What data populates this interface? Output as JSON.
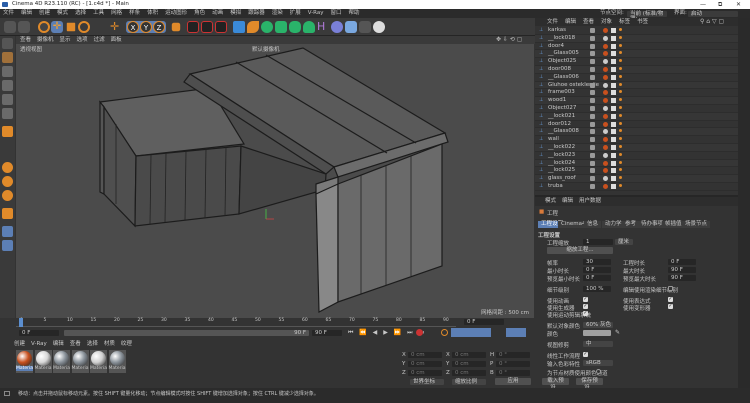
{
  "window": {
    "title": "Cinema 4D R23.110 (RC) - [1.c4d *] - Main",
    "minimize": "—",
    "restore": "⧉",
    "close": "✕"
  },
  "menu": [
    "文件",
    "编辑",
    "创建",
    "模式",
    "选择",
    "工具",
    "网格",
    "样条",
    "体积",
    "运动图形",
    "角色",
    "动画",
    "模拟",
    "跟踪器",
    "渲染",
    "扩展",
    "V-Ray",
    "窗口",
    "帮助"
  ],
  "header": {
    "node_space_label": "节点空间:",
    "node_space_value": "当前 (标准/物理)",
    "layout_label": "界面:",
    "layout_value": "启动"
  },
  "viewport": {
    "menu": [
      "查看",
      "摄像机",
      "显示",
      "选项",
      "过滤",
      "面板"
    ],
    "name": "透视视图",
    "camera": "默认摄像机",
    "grid": "网格间距 : 500 cm",
    "colors": {
      "bg": "#4b4b4b",
      "roof": "#5a5a5a",
      "wall": "#6a6a6a",
      "edge": "#1c1c1c"
    }
  },
  "object_manager": {
    "menu": [
      "文件",
      "编辑",
      "查看",
      "对象",
      "标签",
      "书签"
    ],
    "objects": [
      "karkas",
      "__lock018",
      "door4",
      "__Glass005",
      "Object025",
      "door008",
      "__Glass006",
      "Gluhoe ostekleniie",
      "frame003",
      "wood1",
      "Object027",
      "__lock021",
      "door012",
      "__Glass008",
      "wall",
      "__lock022",
      "__lock023",
      "__lock024",
      "__lock025",
      "glass_roof",
      "truba"
    ]
  },
  "attributes": {
    "menu": [
      "模式",
      "编辑",
      "用户数据"
    ],
    "object": "工程",
    "tabs": [
      "工程设置",
      "Cinema4D",
      "信息",
      "动力学",
      "参考",
      "待办事项",
      "帧插值",
      "场景节点"
    ],
    "section": "工程设置",
    "scale_label": "工程缩放",
    "scale_value": "1",
    "scale_unit": "厘米",
    "scale_button": "缩放工程...",
    "fps_label": "帧率",
    "fps_value": "30",
    "proj_time_label": "工程时长",
    "proj_time_value": "0 F",
    "min_time_label": "最小时长",
    "min_time_value": "0 F",
    "max_time_label": "最大时长",
    "max_time_value": "90 F",
    "prev_min_label": "预览最小时长",
    "prev_min_value": "0 F",
    "prev_max_label": "预览最大时长",
    "prev_max_value": "90 F",
    "lod_label": "细节级别",
    "lod_value": "100 %",
    "render_lod_label": "编辑使用渲染细节级别",
    "use_anim": "使用动画",
    "use_expr": "使用表达式",
    "use_gen": "使用生成器",
    "use_deform": "使用变形器",
    "use_motion": "使用运动剪辑系统",
    "obj_color_label": "默认对象颜色",
    "obj_color_value": "60% 灰色",
    "color_label": "颜色",
    "clip_label": "视图修剪",
    "clip_value": "中",
    "linear_label": "线性工作流程",
    "input_color_label": "输入色彩特性",
    "input_color_value": "sRGB",
    "node_color_label": "为节点材质使用颜色通道",
    "load_preset": "载入预设...",
    "save_preset": "保存预设..."
  },
  "timeline": {
    "ticks": [
      "0",
      "5",
      "10",
      "15",
      "20",
      "25",
      "30",
      "35",
      "40",
      "45",
      "50",
      "55",
      "60",
      "65",
      "70",
      "75",
      "80",
      "85",
      "90"
    ],
    "current": "0 F",
    "start": "0 F",
    "range_end": "90 F",
    "end": "90 F",
    "playhead": 0
  },
  "materials": {
    "menu": [
      "创建",
      "V-Ray",
      "编辑",
      "查看",
      "选择",
      "材质",
      "纹理"
    ],
    "items": [
      {
        "name": "Materia",
        "color": "#c8501e"
      },
      {
        "name": "Materia",
        "color": "#d8d8d8"
      },
      {
        "name": "Materia",
        "color": "#8a929a"
      },
      {
        "name": "Materia",
        "color": "#8a929a"
      },
      {
        "name": "Materia",
        "color": "#d0d0d0"
      },
      {
        "name": "Materia",
        "color": "#8a929a"
      }
    ]
  },
  "coordinates": {
    "rows": [
      [
        "X",
        "0 cm",
        "X",
        "0 cm",
        "H",
        "0 °"
      ],
      [
        "Y",
        "0 cm",
        "Y",
        "0 cm",
        "P",
        "0 °"
      ],
      [
        "Z",
        "0 cm",
        "Z",
        "0 cm",
        "B",
        "0 °"
      ]
    ],
    "mode": "世界坐标",
    "scale": "缩放比例",
    "apply": "应用"
  },
  "status": "移动：点击并拖动鼠标移动元素。按住 SHIFT 键量化移动；节点编辑模式时按住 SHIFT 键增加选择对象；按住 CTRL 键减少选择对象。"
}
